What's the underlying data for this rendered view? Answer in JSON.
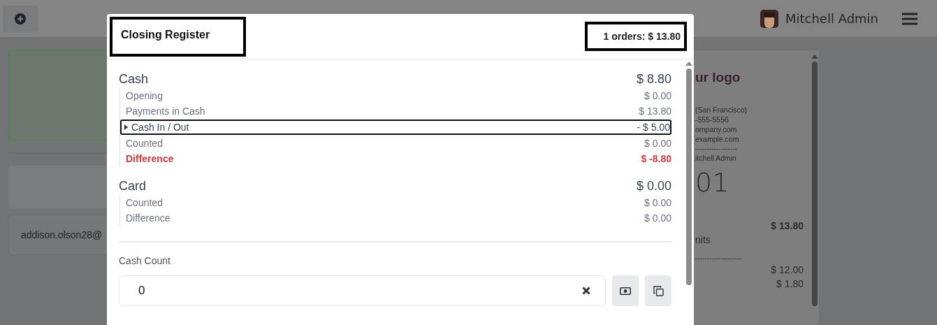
{
  "topbar": {
    "user": "Mitchell Admin"
  },
  "left_panel": {
    "customer_email": "addison.olson28@"
  },
  "receipt": {
    "lines": [
      {
        "kind": "logo",
        "text": "ur logo"
      },
      {
        "kind": "small",
        "text": "(San Francisco)"
      },
      {
        "kind": "small",
        "text": "-555-5556"
      },
      {
        "kind": "small",
        "text": "ompany.com"
      },
      {
        "kind": "small",
        "text": "example.com"
      },
      {
        "kind": "rule",
        "text": "------------------"
      },
      {
        "kind": "small",
        "text": "itchell Admin"
      },
      {
        "kind": "big",
        "text": "01"
      },
      {
        "kind": "total",
        "text": "$ 13.80"
      },
      {
        "kind": "normal",
        "text": "nits"
      },
      {
        "kind": "rule",
        "text": "--------------------"
      },
      {
        "kind": "amount",
        "text": "$ 12.00"
      },
      {
        "kind": "amount",
        "text": "$ 1.80"
      }
    ]
  },
  "dialog": {
    "title": "Closing Register",
    "title_highlighted": true,
    "orders": "1 orders: $ 13.80",
    "orders_highlighted": true,
    "methods": [
      {
        "name": "Cash",
        "amount": "$ 8.80",
        "rows": [
          {
            "label": "Opening",
            "value": "$ 0.00",
            "kind": "plain",
            "highlighted": false
          },
          {
            "label": "Payments in Cash",
            "value": "$ 13.80",
            "kind": "plain",
            "highlighted": false
          },
          {
            "label": "Cash In / Out",
            "value": "- $ 5.00",
            "kind": "expandable",
            "highlighted": true
          },
          {
            "label": "Counted",
            "value": "$ 0.00",
            "kind": "plain",
            "highlighted": false
          },
          {
            "label": "Difference",
            "value": "$ -8.80",
            "kind": "alert",
            "highlighted": false
          }
        ]
      },
      {
        "name": "Card",
        "amount": "$ 0.00",
        "rows": [
          {
            "label": "Counted",
            "value": "$ 0.00",
            "kind": "plain",
            "highlighted": false
          },
          {
            "label": "Difference",
            "value": "$ 0.00",
            "kind": "plain",
            "highlighted": false
          }
        ]
      }
    ],
    "cash_count": {
      "label": "Cash Count",
      "value": "0"
    }
  }
}
